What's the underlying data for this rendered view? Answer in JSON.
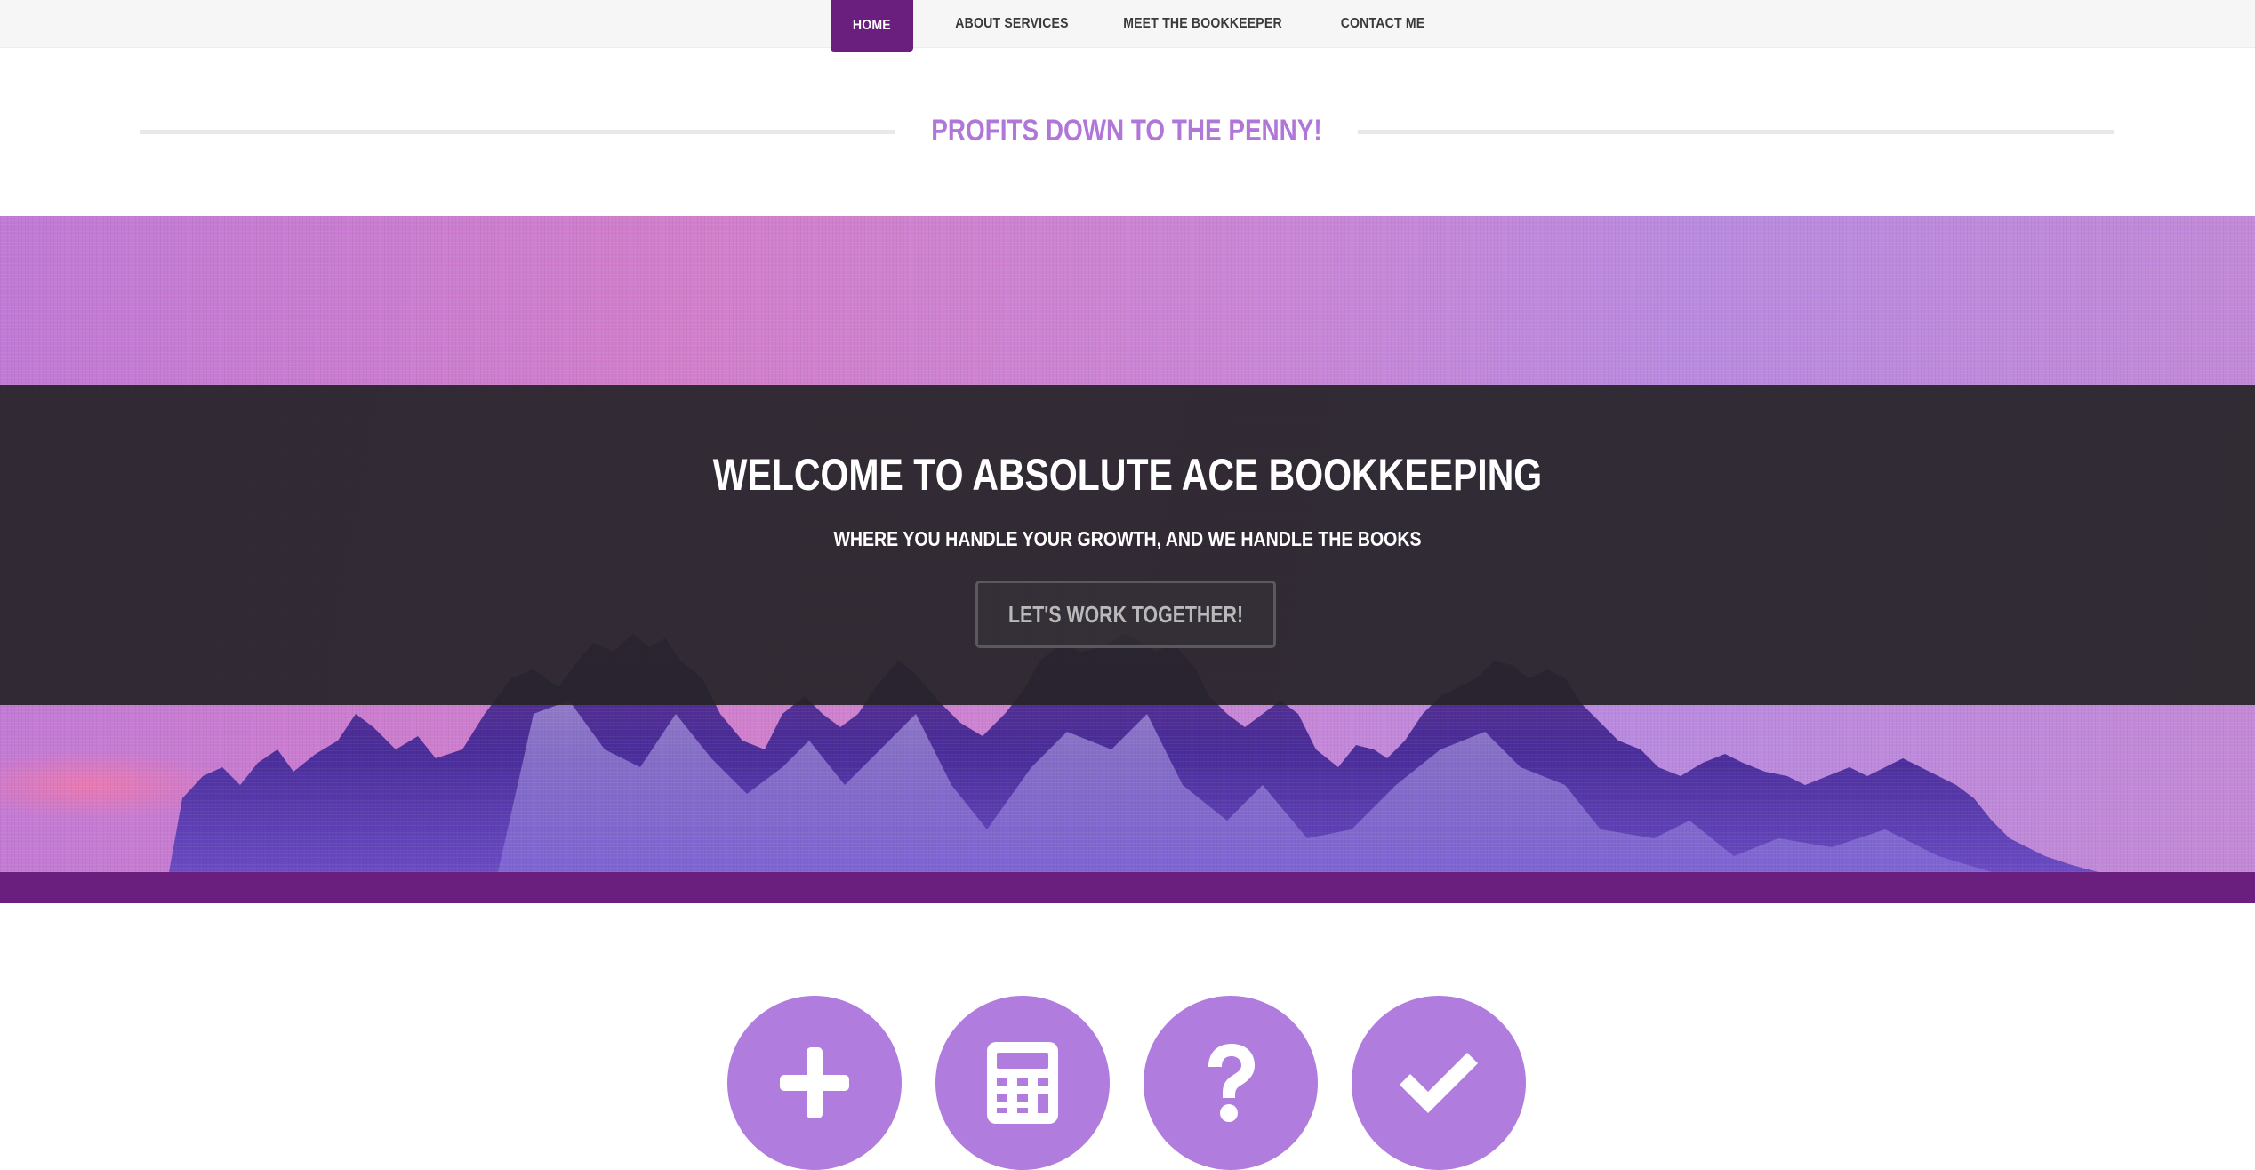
{
  "nav": {
    "items": [
      {
        "label": "HOME",
        "active": true
      },
      {
        "label": "ABOUT SERVICES",
        "active": false
      },
      {
        "label": "MEET THE BOOKKEEPER",
        "active": false
      },
      {
        "label": "CONTACT ME",
        "active": false
      }
    ]
  },
  "tagline": {
    "text": "PROFITS DOWN TO THE PENNY!"
  },
  "hero": {
    "title": "WELCOME TO ABSOLUTE ACE BOOKKEEPING",
    "subtitle": "WHERE YOU HANDLE YOUR GROWTH, AND WE HANDLE THE BOOKS",
    "cta_label": "LET'S WORK TOGETHER!"
  },
  "features": {
    "icons": [
      "plus-icon",
      "calculator-icon",
      "question-icon",
      "check-icon"
    ]
  },
  "colors": {
    "brand": "#6a1f7e",
    "accent": "#b07dde",
    "tagline": "#b077d9",
    "overlay": "#262428"
  }
}
